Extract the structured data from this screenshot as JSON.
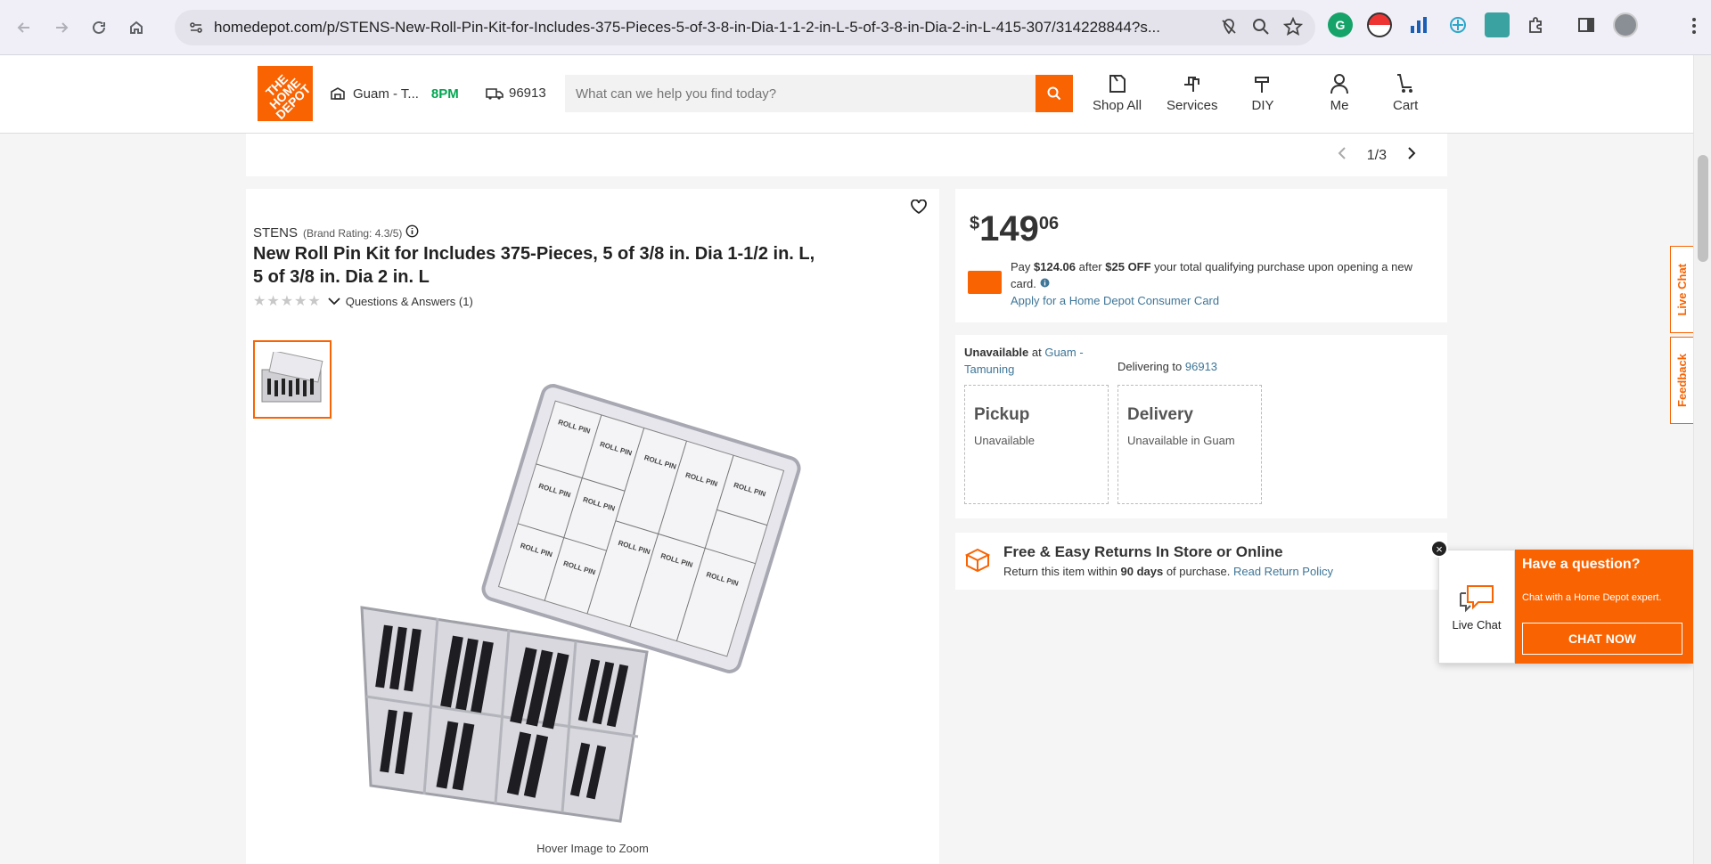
{
  "browser": {
    "url": "homedepot.com/p/STENS-New-Roll-Pin-Kit-for-Includes-375-Pieces-5-of-3-8-in-Dia-1-1-2-in-L-5-of-3-8-in-Dia-2-in-L-415-307/314228844?s..."
  },
  "header": {
    "logo_text": "THE HOME DEPOT",
    "store_label": "Guam - T...",
    "store_hours": "8PM",
    "zip": "96913",
    "search_placeholder": "What can we help you find today?",
    "nav": [
      {
        "label": "Shop All"
      },
      {
        "label": "Services"
      },
      {
        "label": "DIY"
      },
      {
        "label": "Me"
      },
      {
        "label": "Cart"
      }
    ]
  },
  "pager": {
    "text": "1/3"
  },
  "product": {
    "brand": "STENS",
    "brand_rating": "(Brand Rating: 4.3/5)",
    "title": "New Roll Pin Kit for Includes 375-Pieces, 5 of 3/8 in. Dia 1-1/2 in. L, 5 of 3/8 in. Dia 2 in. L",
    "rating_stars": 0,
    "qa_label": "Questions & Answers (1)",
    "hover_text": "Hover Image to Zoom"
  },
  "price": {
    "dollar": "$",
    "whole": "149",
    "cents": "06",
    "promo_pay": "Pay ",
    "promo_amount": "$124.06",
    "promo_after": " after ",
    "promo_off": "$25 OFF",
    "promo_rest": " your total qualifying purchase upon opening a new card.",
    "apply_link": "Apply for a Home Depot Consumer Card"
  },
  "fulfillment": {
    "unavailable_label": "Unavailable",
    "at": " at ",
    "store": "Guam - Tamuning",
    "delivering_to": "Delivering to ",
    "zip": "96913",
    "pickup_title": "Pickup",
    "pickup_status": "Unavailable",
    "delivery_title": "Delivery",
    "delivery_status": "Unavailable in Guam"
  },
  "returns": {
    "title": "Free & Easy Returns In Store or Online",
    "text_pre": "Return this item within ",
    "days": "90 days",
    "text_post": " of purchase. ",
    "link": "Read Return Policy"
  },
  "sidetabs": {
    "live_chat": "Live Chat",
    "feedback": "Feedback"
  },
  "chat": {
    "label": "Live Chat",
    "question": "Have a question?",
    "sub": "Chat with a Home Depot expert.",
    "button": "CHAT NOW"
  },
  "colors": {
    "brand": "#f96302",
    "link": "#3e7697"
  }
}
